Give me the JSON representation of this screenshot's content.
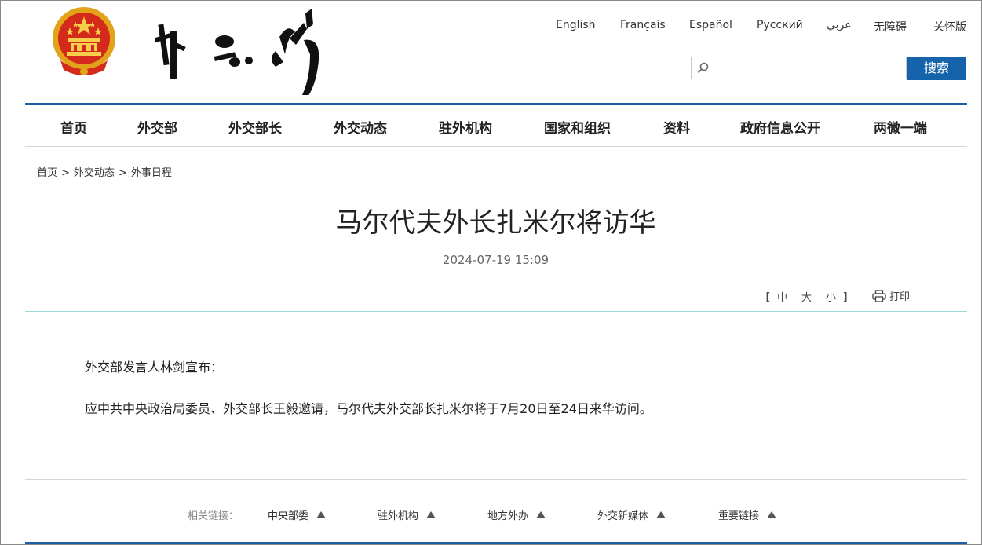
{
  "header": {
    "languages": [
      "English",
      "Français",
      "Español",
      "Русский",
      "عربي",
      "无障碍",
      "关怀版"
    ],
    "search": {
      "placeholder": "",
      "button_label": "搜索"
    }
  },
  "nav": {
    "items": [
      "首页",
      "外交部",
      "外交部长",
      "外交动态",
      "驻外机构",
      "国家和组织",
      "资料",
      "政府信息公开",
      "两微一端"
    ]
  },
  "breadcrumb": [
    "首页",
    "外交动态",
    "外事日程"
  ],
  "article": {
    "title": "马尔代夫外长扎米尔将访华",
    "date": "2024-07-19 15:09",
    "font_size": {
      "open": "【",
      "options": [
        "中",
        "大",
        "小"
      ],
      "close": "】"
    },
    "print_label": "打印",
    "paragraphs": [
      "外交部发言人林剑宣布：",
      "应中共中央政治局委员、外交部长王毅邀请，马尔代夫外交部长扎米尔将于7月20日至24日来华访问。"
    ]
  },
  "footer": {
    "label": "相关链接：",
    "links": [
      "中央部委",
      "驻外机构",
      "地方外办",
      "外交新媒体",
      "重要链接"
    ]
  },
  "colors": {
    "accent": "#1564ab",
    "nav_line": "#1a5fa3",
    "divider": "#9fd8dc"
  }
}
